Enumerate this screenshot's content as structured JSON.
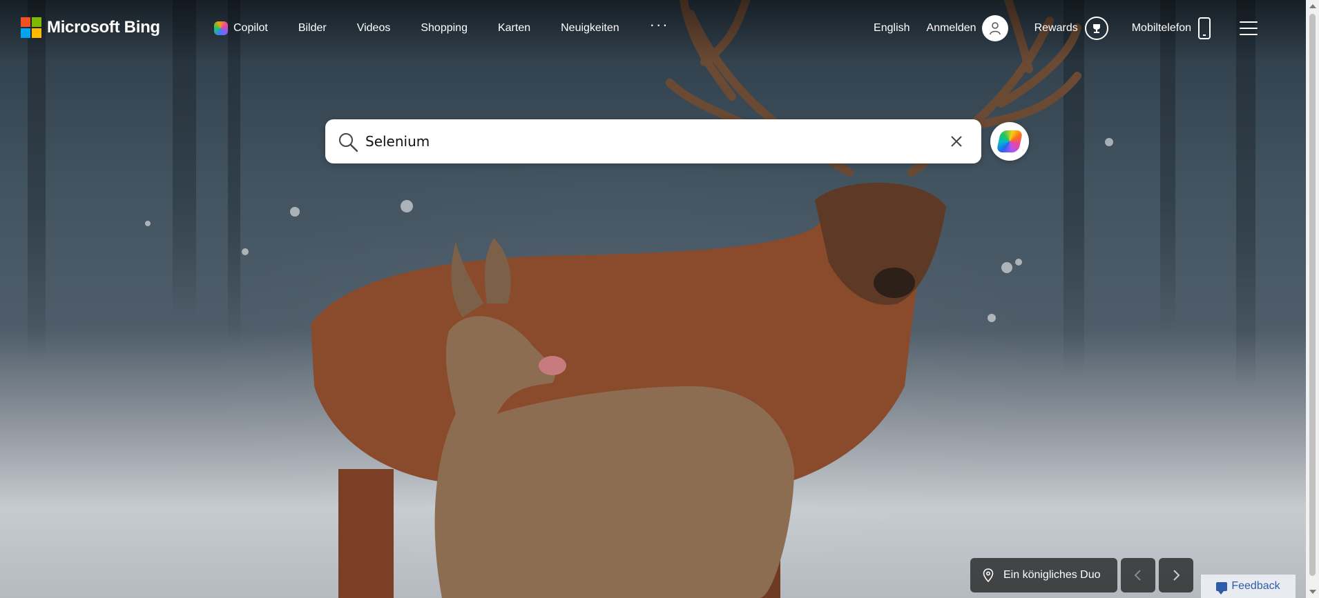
{
  "header": {
    "brand": "Microsoft Bing",
    "nav": [
      {
        "label": "Copilot",
        "icon": "copilot-icon"
      },
      {
        "label": "Bilder"
      },
      {
        "label": "Videos"
      },
      {
        "label": "Shopping"
      },
      {
        "label": "Karten"
      },
      {
        "label": "Neuigkeiten"
      }
    ],
    "more_label": "···",
    "language": "English",
    "signin": "Anmelden",
    "rewards": "Rewards",
    "mobile": "Mobiltelefon",
    "icons": {
      "more": "more-dots-icon",
      "avatar": "user-avatar-icon",
      "rewards": "trophy-icon",
      "mobile": "phone-icon",
      "menu": "hamburger-menu-icon"
    }
  },
  "search": {
    "value": "Selenium",
    "icons": {
      "search": "search-icon",
      "clear": "close-icon",
      "copilot": "copilot-icon"
    }
  },
  "image_info": {
    "caption": "Ein königliches Duo",
    "icons": {
      "location": "location-pin-icon",
      "prev": "chevron-left-icon",
      "next": "chevron-right-icon"
    }
  },
  "feedback": {
    "label": "Feedback",
    "icon": "feedback-icon"
  },
  "colors": {
    "ms_red": "#f25022",
    "ms_green": "#7fba00",
    "ms_blue": "#00a4ef",
    "ms_yellow": "#ffb900",
    "feedback_text": "#2e5ca8",
    "feedback_bg": "#e8ecf1"
  }
}
